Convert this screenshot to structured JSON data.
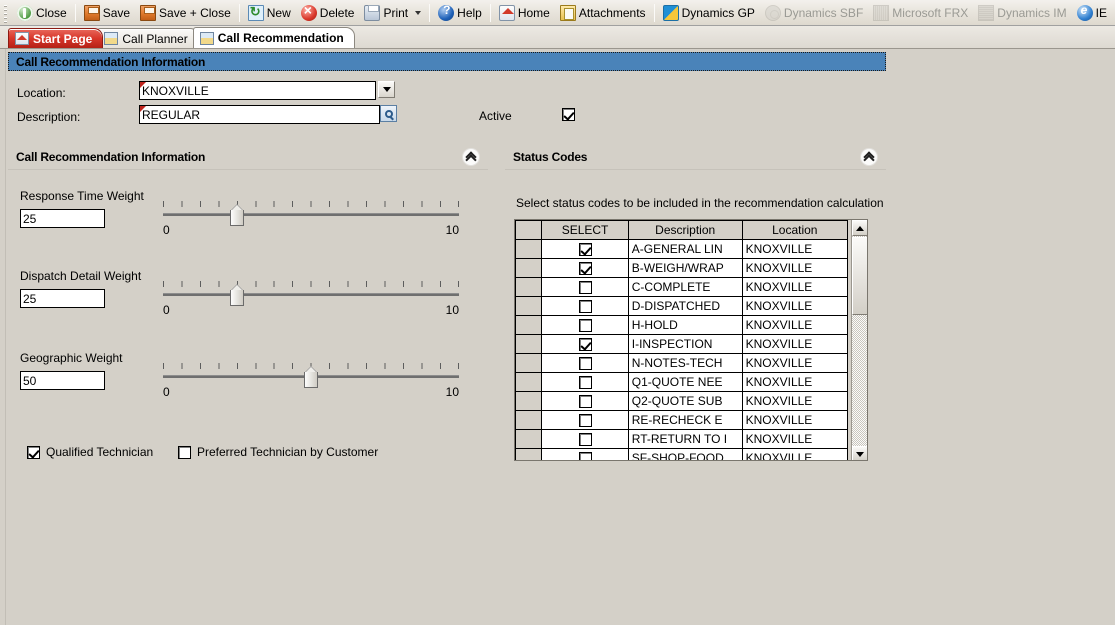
{
  "toolbar": {
    "buttons": [
      {
        "label": "Close",
        "icon": "close-icon",
        "disabled": false,
        "dropdown": false
      },
      {
        "label": "Save",
        "icon": "save-icon",
        "disabled": false,
        "dropdown": false
      },
      {
        "label": "Save + Close",
        "icon": "save-close-icon",
        "disabled": false,
        "dropdown": false
      },
      {
        "label": "New",
        "icon": "new-icon",
        "disabled": false,
        "dropdown": false
      },
      {
        "label": "Delete",
        "icon": "delete-icon",
        "disabled": false,
        "dropdown": false
      },
      {
        "label": "Print",
        "icon": "print-icon",
        "disabled": false,
        "dropdown": true
      },
      {
        "label": "Help",
        "icon": "help-icon",
        "disabled": false,
        "dropdown": false
      },
      {
        "label": "Home",
        "icon": "home-icon",
        "disabled": false,
        "dropdown": false
      },
      {
        "label": "Attachments",
        "icon": "attachments-icon",
        "disabled": false,
        "dropdown": false
      },
      {
        "label": "Dynamics GP",
        "icon": "dynamics-gp-icon",
        "disabled": false,
        "dropdown": false
      },
      {
        "label": "Dynamics SBF",
        "icon": "dynamics-sbf-icon",
        "disabled": true,
        "dropdown": false
      },
      {
        "label": "Microsoft FRX",
        "icon": "microsoft-frx-icon",
        "disabled": true,
        "dropdown": false
      },
      {
        "label": "Dynamics IM",
        "icon": "dynamics-im-icon",
        "disabled": true,
        "dropdown": false
      },
      {
        "label": "IE",
        "icon": "ie-icon",
        "disabled": false,
        "dropdown": false
      }
    ]
  },
  "tabs": [
    {
      "label": "Start Page",
      "state": "start"
    },
    {
      "label": "Call Planner",
      "state": "plain"
    },
    {
      "label": "Call Recommendation",
      "state": "selected"
    }
  ],
  "window": {
    "title": "Call Recommendation Information"
  },
  "header_fields": {
    "location_label": "Location:",
    "location_value": "KNOXVILLE",
    "description_label": "Description:",
    "description_value": "REGULAR",
    "active_label": "Active",
    "active_checked": true
  },
  "left_section": {
    "title": "Call Recommendation Information",
    "weights": [
      {
        "label": "Response Time Weight",
        "value": "25",
        "min": "0",
        "max": "10",
        "thumb_pct": 25
      },
      {
        "label": "Dispatch Detail Weight",
        "value": "25",
        "min": "0",
        "max": "10",
        "thumb_pct": 25
      },
      {
        "label": "Geographic Weight",
        "value": "50",
        "min": "0",
        "max": "10",
        "thumb_pct": 50
      }
    ],
    "checkboxes": [
      {
        "label": "Qualified Technician",
        "checked": true
      },
      {
        "label": "Preferred Technician by Customer",
        "checked": false
      }
    ]
  },
  "right_section": {
    "title": "Status Codes",
    "instruction": "Select status codes to be included in the recommendation calculation",
    "grid": {
      "columns": [
        "SELECT",
        "Description",
        "Location"
      ],
      "rows": [
        {
          "select": true,
          "description": "A-GENERAL LIN",
          "location": "KNOXVILLE"
        },
        {
          "select": true,
          "description": "B-WEIGH/WRAP",
          "location": "KNOXVILLE"
        },
        {
          "select": false,
          "description": "C-COMPLETE",
          "location": "KNOXVILLE"
        },
        {
          "select": false,
          "description": "D-DISPATCHED",
          "location": "KNOXVILLE"
        },
        {
          "select": false,
          "description": "H-HOLD",
          "location": "KNOXVILLE"
        },
        {
          "select": true,
          "description": "I-INSPECTION",
          "location": "KNOXVILLE"
        },
        {
          "select": false,
          "description": "N-NOTES-TECH",
          "location": "KNOXVILLE"
        },
        {
          "select": false,
          "description": "Q1-QUOTE NEE",
          "location": "KNOXVILLE"
        },
        {
          "select": false,
          "description": "Q2-QUOTE SUB",
          "location": "KNOXVILLE"
        },
        {
          "select": false,
          "description": "RE-RECHECK E",
          "location": "KNOXVILLE"
        },
        {
          "select": false,
          "description": "RT-RETURN TO I",
          "location": "KNOXVILLE"
        },
        {
          "select": false,
          "description": "SF-SHOP-FOOD",
          "location": "KNOXVILLE"
        }
      ]
    }
  },
  "colors": {
    "titlebar_blue": "#4a83b9",
    "window_gray": "#d4d0c8",
    "start_tab_red": "#d8362a",
    "required_mark": "#c0251d"
  }
}
